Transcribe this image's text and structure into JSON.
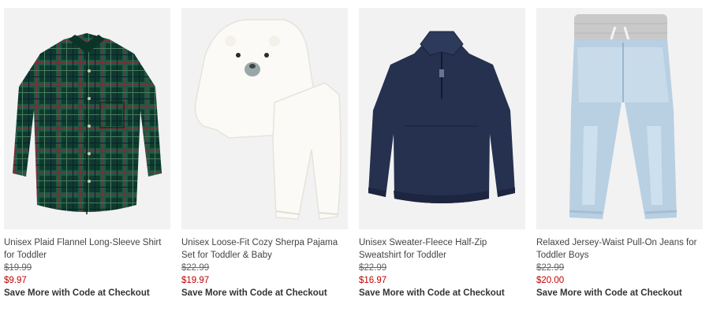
{
  "colors": {
    "sale_price": "#c00000",
    "image_bg": "#f2f2f2"
  },
  "products": [
    {
      "title": "Unisex Plaid Flannel Long-Sleeve Shirt for Toddler",
      "was_price": "$19.99",
      "now_price": "$9.97",
      "promo": "Save More with Code at Checkout",
      "image_icon": "plaid-flannel-shirt-image"
    },
    {
      "title": "Unisex Loose-Fit Cozy Sherpa Pajama Set for Toddler & Baby",
      "was_price": "$22.99",
      "now_price": "$19.97",
      "promo": "Save More with Code at Checkout",
      "image_icon": "sherpa-bear-pajama-set-image"
    },
    {
      "title": "Unisex Sweater-Fleece Half-Zip Sweatshirt for Toddler",
      "was_price": "$22.99",
      "now_price": "$16.97",
      "promo": "Save More with Code at Checkout",
      "image_icon": "navy-half-zip-sweatshirt-image"
    },
    {
      "title": "Relaxed Jersey-Waist Pull-On Jeans for Toddler Boys",
      "was_price": "$22.99",
      "now_price": "$20.00",
      "promo": "Save More with Code at Checkout",
      "image_icon": "light-wash-jeans-image"
    }
  ]
}
